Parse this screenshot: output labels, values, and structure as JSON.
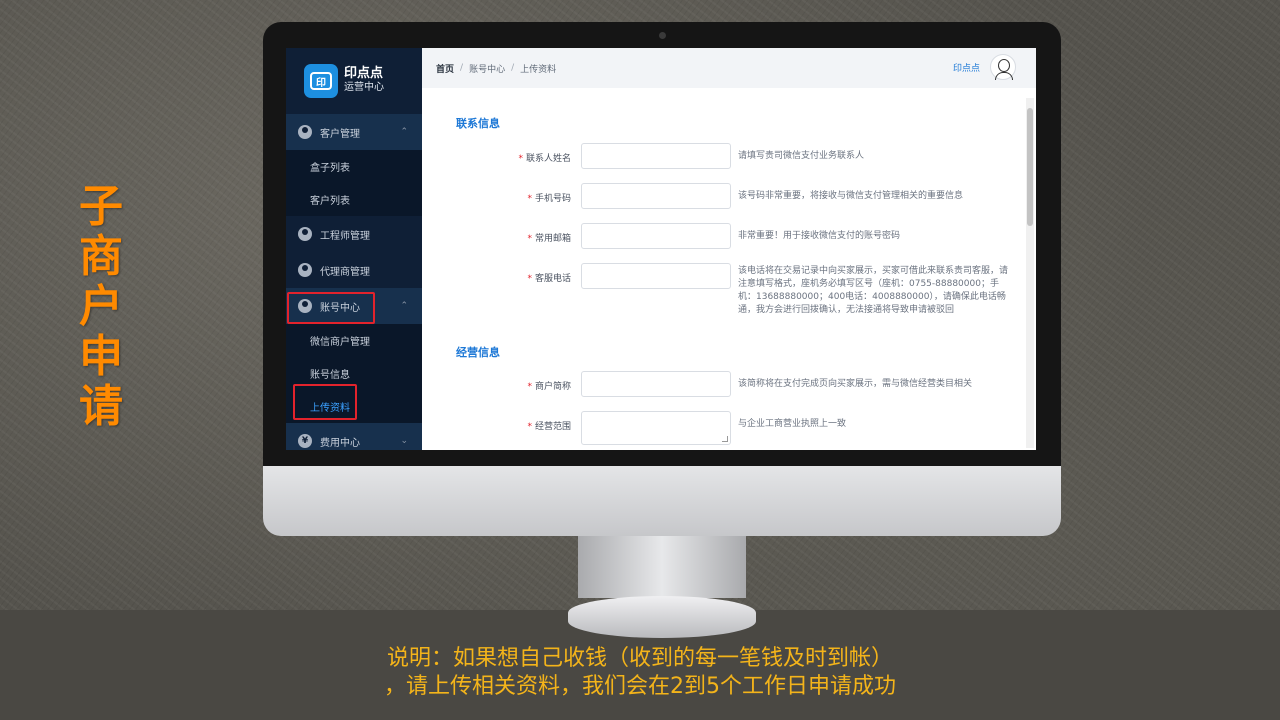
{
  "slide": {
    "side_title": "子商户申请",
    "caption_line1": "说明：如果想自己收钱（收到的每一笔钱及时到帐）",
    "caption_line2": "，请上传相关资料，我们会在2到5个工作日申请成功"
  },
  "app": {
    "logo_name": "印点点",
    "logo_subtitle": "运营中心",
    "logo_glyph": "印"
  },
  "sidebar": {
    "groups": [
      {
        "label": "客户管理",
        "icon": "user-group-icon",
        "expanded": true
      },
      {
        "label": "工程师管理",
        "icon": "engineer-icon"
      },
      {
        "label": "代理商管理",
        "icon": "agent-icon"
      },
      {
        "label": "账号中心",
        "icon": "account-icon",
        "expanded": true
      },
      {
        "label": "费用中心",
        "icon": "yen-icon",
        "icon_glyph": "¥",
        "expanded": false
      }
    ],
    "customer_items": [
      "盒子列表",
      "客户列表"
    ],
    "account_items": [
      "微信商户管理",
      "账号信息",
      "上传资料"
    ],
    "chevron_up": "⌃",
    "chevron_down": "⌄"
  },
  "header": {
    "breadcrumb": [
      "首页",
      "账号中心",
      "上传资料"
    ],
    "separator": "/",
    "username": "印点点"
  },
  "form": {
    "section_contact": "联系信息",
    "section_business": "经营信息",
    "required_mark": "*",
    "fields": [
      {
        "label": "联系人姓名",
        "value": "",
        "hint": "请填写贵司微信支付业务联系人"
      },
      {
        "label": "手机号码",
        "value": "",
        "hint": "该号码非常重要，将接收与微信支付管理相关的重要信息"
      },
      {
        "label": "常用邮箱",
        "value": "",
        "hint": "非常重要！用于接收微信支付的账号密码"
      },
      {
        "label": "客服电话",
        "value": "",
        "hint": "该电话将在交易记录中向买家展示，买家可借此来联系贵司客服，请注意填写格式，座机务必填写区号（座机：0755-88880000；手机：13688880000；400电话：4008880000），请确保此电话畅通，我方会进行回拨确认，无法接通将导致申请被驳回"
      },
      {
        "label": "商户简称",
        "value": "",
        "hint": "该简称将在支付完成页向买家展示，需与微信经营类目相关"
      },
      {
        "label": "经营范围",
        "value": "",
        "hint": "与企业工商营业执照上一致"
      }
    ]
  },
  "colors": {
    "accent": "#1d78d6",
    "title_orange": "#ff8a00",
    "caption_yellow": "#f4b41a",
    "highlight_red": "#e3232c",
    "sidebar_bg": "#0f1f36"
  }
}
